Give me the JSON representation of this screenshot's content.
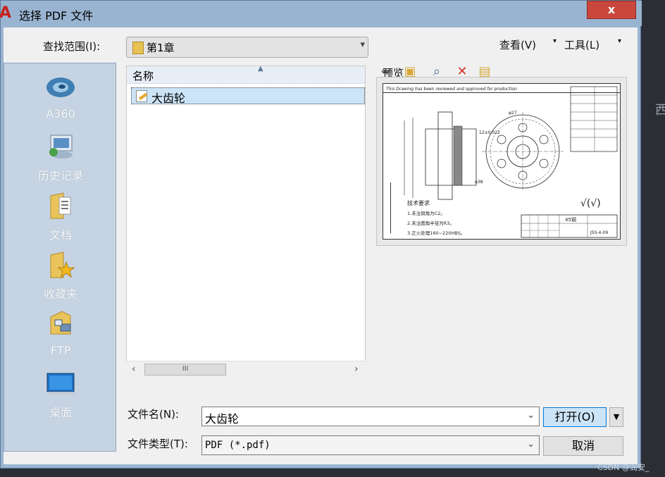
{
  "window": {
    "title": "选择 PDF 文件",
    "close_glyph": "x",
    "app_logo": "A"
  },
  "lookin": {
    "label": "查找范围(I):",
    "value": "第1章"
  },
  "toolbar": {
    "view_label": "查看(V)",
    "tools_label": "工具(L)"
  },
  "places": [
    {
      "label": "A360",
      "icon": "a360-icon"
    },
    {
      "label": "历史记录",
      "icon": "history-icon"
    },
    {
      "label": "文档",
      "icon": "documents-icon"
    },
    {
      "label": "收藏夹",
      "icon": "favorites-icon"
    },
    {
      "label": "FTP",
      "icon": "ftp-icon"
    },
    {
      "label": "桌面",
      "icon": "desktop-icon"
    }
  ],
  "filelist": {
    "column_header": "名称",
    "items": [
      {
        "name": "大齿轮",
        "selected": true
      }
    ],
    "scroll_thumb": "III"
  },
  "preview": {
    "label": "预览",
    "drawing_caption": "This Drawing has been reviewed and approved for production",
    "tech_heading": "技术要求",
    "tech_notes": [
      "1.未注倒角为C2。",
      "2.未注圆角半径为R3。",
      "3.正火处理160~220HBS。"
    ],
    "material": "45钢",
    "drawing_no": "JSS-4-09",
    "roughness": "√(√)",
    "dim_center": "φ27",
    "dim_bore": "φ38",
    "tolerance": "12±0.022"
  },
  "form": {
    "filename_label": "文件名(N):",
    "filename_value": "大齿轮",
    "filetype_label": "文件类型(T):",
    "filetype_value": "PDF (*.pdf)",
    "open_label": "打开(O)",
    "cancel_label": "取消"
  },
  "background": {
    "side_text": "西",
    "watermark": "CSDN @润安_"
  }
}
